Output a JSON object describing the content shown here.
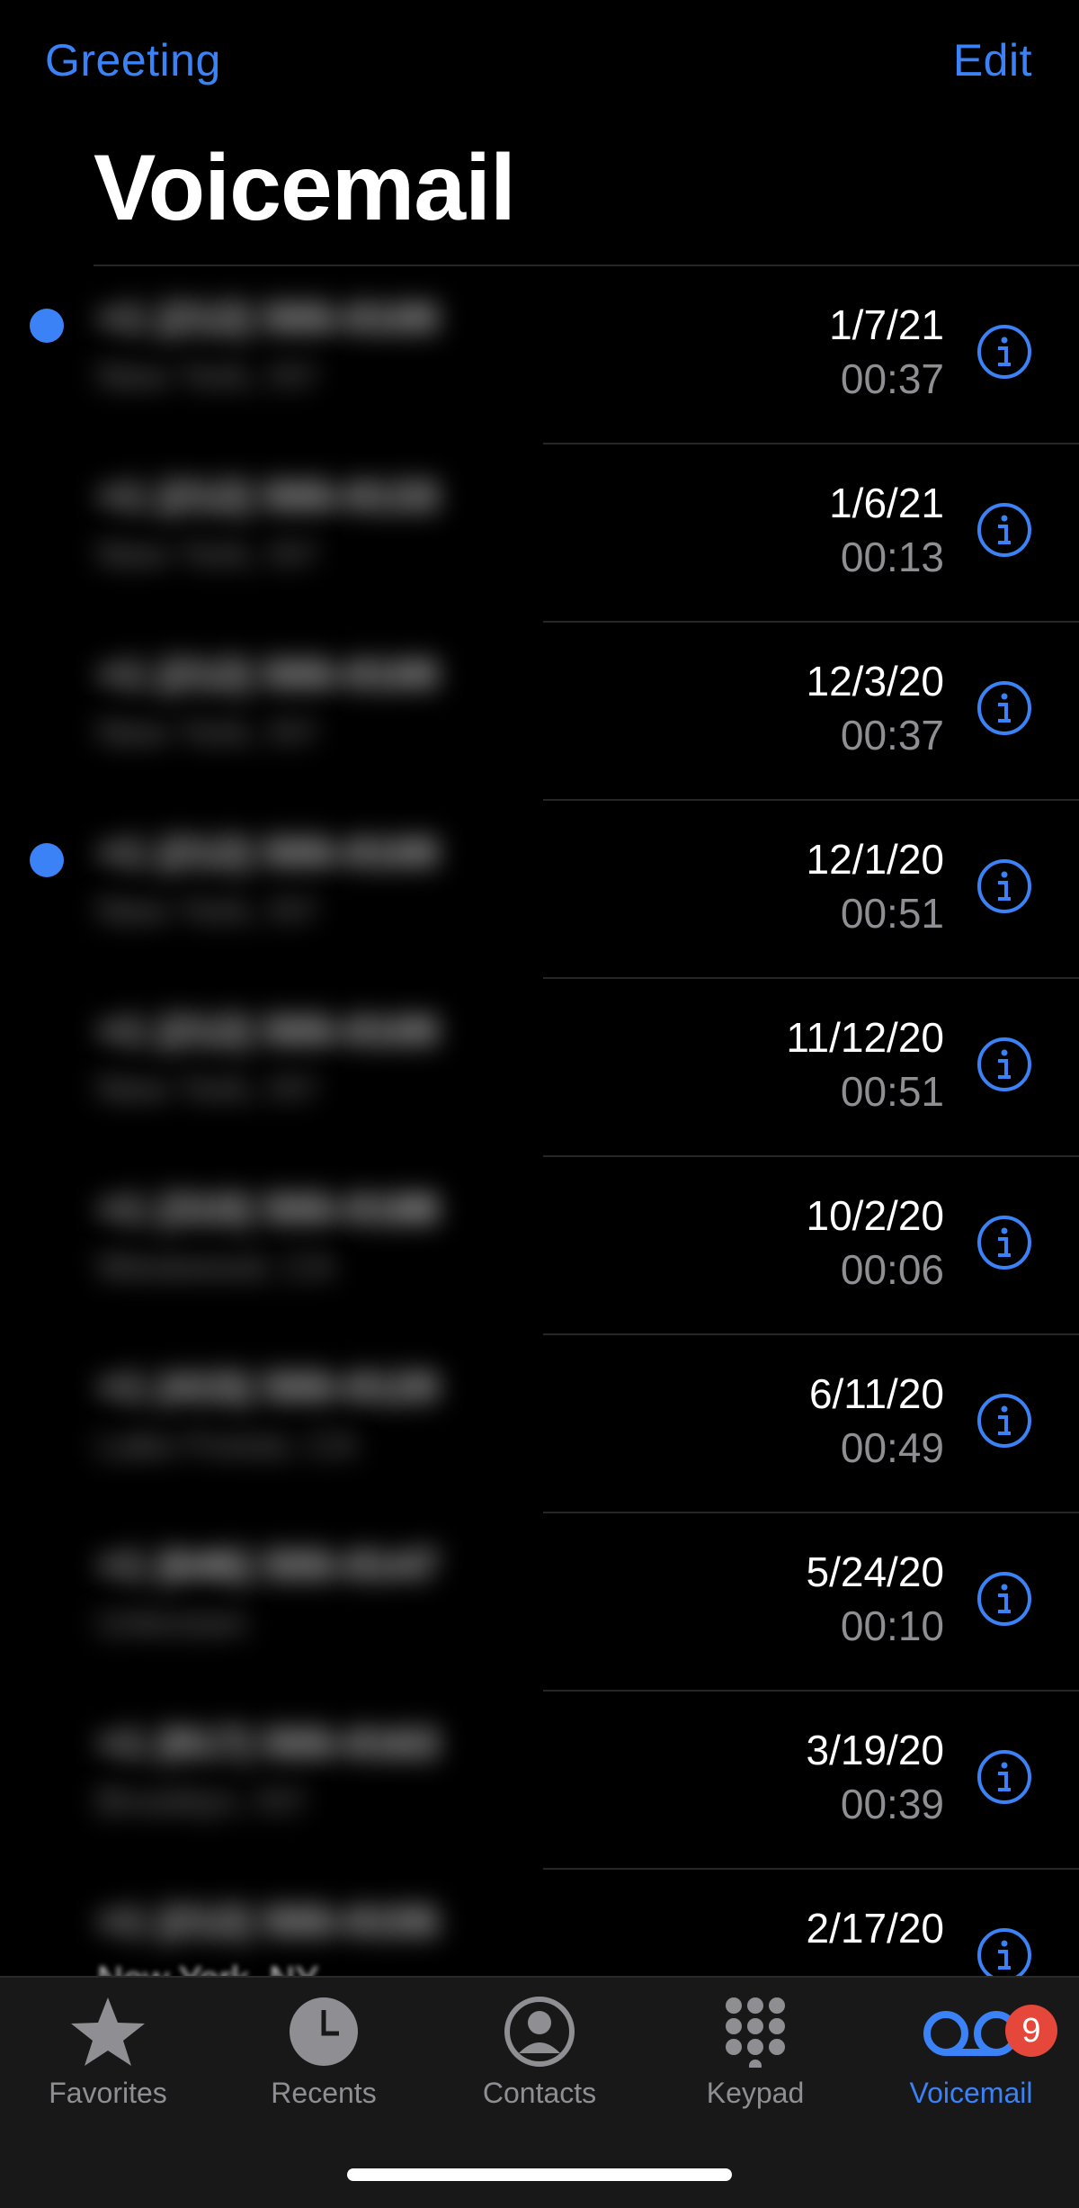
{
  "nav": {
    "left_label": "Greeting",
    "right_label": "Edit"
  },
  "title": "Voicemail",
  "colors": {
    "accent": "#3b82f6",
    "badge": "#e5473b",
    "secondary_text": "#8e8e93"
  },
  "voicemails": [
    {
      "date": "1/7/21",
      "duration": "00:37",
      "unread": true
    },
    {
      "date": "1/6/21",
      "duration": "00:13",
      "unread": false
    },
    {
      "date": "12/3/20",
      "duration": "00:37",
      "unread": false
    },
    {
      "date": "12/1/20",
      "duration": "00:51",
      "unread": true
    },
    {
      "date": "11/12/20",
      "duration": "00:51",
      "unread": false
    },
    {
      "date": "10/2/20",
      "duration": "00:06",
      "unread": false
    },
    {
      "date": "6/11/20",
      "duration": "00:49",
      "unread": false
    },
    {
      "date": "5/24/20",
      "duration": "00:10",
      "unread": false
    },
    {
      "date": "3/19/20",
      "duration": "00:39",
      "unread": false
    },
    {
      "date": "2/17/20",
      "duration": "",
      "unread": false
    }
  ],
  "partial_location": "New York, NY",
  "tabs": [
    {
      "label": "Favorites",
      "icon": "star-icon"
    },
    {
      "label": "Recents",
      "icon": "clock-icon"
    },
    {
      "label": "Contacts",
      "icon": "person-circle-icon"
    },
    {
      "label": "Keypad",
      "icon": "keypad-icon"
    },
    {
      "label": "Voicemail",
      "icon": "voicemail-icon",
      "active": true,
      "badge": "9"
    }
  ]
}
